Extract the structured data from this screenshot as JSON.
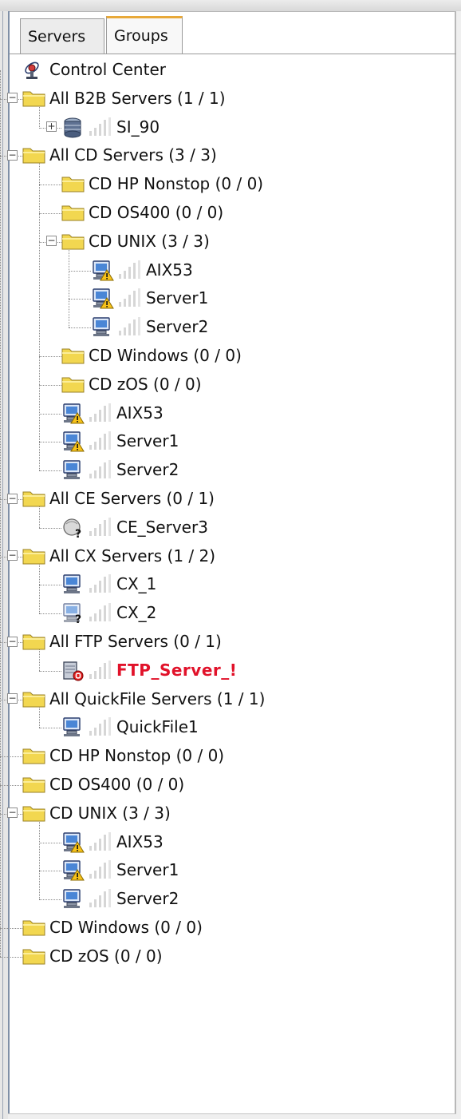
{
  "tabs": [
    {
      "label": "Servers",
      "selected": false
    },
    {
      "label": "Groups",
      "selected": true
    }
  ],
  "colors": {
    "error_text": "#e1122a",
    "tab_accent": "#e8a93a",
    "folder": "#f2d750"
  },
  "tree": [
    {
      "label": "Control Center",
      "icon": "control-center-icon",
      "level": 0
    },
    {
      "label": "All B2B Servers (1 / 1)",
      "icon": "folder-icon",
      "level": 0,
      "expander": "minus"
    },
    {
      "label": "SI_90",
      "icon": "database-server-icon",
      "level": 1,
      "expander": "plus",
      "signal": true
    },
    {
      "label": "All CD Servers (3 / 3)",
      "icon": "folder-icon",
      "level": 0,
      "expander": "minus"
    },
    {
      "label": "CD HP Nonstop (0 / 0)",
      "icon": "folder-icon",
      "level": 1
    },
    {
      "label": "CD OS400 (0 / 0)",
      "icon": "folder-icon",
      "level": 1
    },
    {
      "label": "CD UNIX (3 / 3)",
      "icon": "folder-icon",
      "level": 1,
      "expander": "minus"
    },
    {
      "label": "AIX53",
      "icon": "server-warning-icon",
      "level": 2,
      "signal": true
    },
    {
      "label": "Server1",
      "icon": "server-warning-icon",
      "level": 2,
      "signal": true
    },
    {
      "label": "Server2",
      "icon": "server-icon",
      "level": 2,
      "signal": true
    },
    {
      "label": "CD Windows (0 / 0)",
      "icon": "folder-icon",
      "level": 1
    },
    {
      "label": "CD zOS (0 / 0)",
      "icon": "folder-icon",
      "level": 1
    },
    {
      "label": "AIX53",
      "icon": "server-warning-icon",
      "level": 1,
      "signal": true
    },
    {
      "label": "Server1",
      "icon": "server-warning-icon",
      "level": 1,
      "signal": true
    },
    {
      "label": "Server2",
      "icon": "server-icon",
      "level": 1,
      "signal": true
    },
    {
      "label": "All CE Servers (0 / 1)",
      "icon": "folder-icon",
      "level": 0,
      "expander": "minus"
    },
    {
      "label": "CE_Server3",
      "icon": "unknown-ce-server-icon",
      "level": 1,
      "signal": true
    },
    {
      "label": "All CX Servers (1 / 2)",
      "icon": "folder-icon",
      "level": 0,
      "expander": "minus"
    },
    {
      "label": "CX_1",
      "icon": "server-icon",
      "level": 1,
      "signal": true
    },
    {
      "label": "CX_2",
      "icon": "server-unknown-icon",
      "level": 1,
      "signal": true
    },
    {
      "label": "All FTP Servers (0 / 1)",
      "icon": "folder-icon",
      "level": 0,
      "expander": "minus"
    },
    {
      "label": "FTP_Server_!",
      "icon": "ftp-server-error-icon",
      "level": 1,
      "signal": true,
      "error": true
    },
    {
      "label": "All QuickFile Servers (1 / 1)",
      "icon": "folder-icon",
      "level": 0,
      "expander": "minus"
    },
    {
      "label": "QuickFile1",
      "icon": "server-icon",
      "level": 1,
      "signal": true
    },
    {
      "label": "CD HP Nonstop (0 / 0)",
      "icon": "folder-icon",
      "level": 0
    },
    {
      "label": "CD OS400 (0 / 0)",
      "icon": "folder-icon",
      "level": 0
    },
    {
      "label": "CD UNIX (3 / 3)",
      "icon": "folder-icon",
      "level": 0,
      "expander": "minus"
    },
    {
      "label": "AIX53",
      "icon": "server-warning-icon",
      "level": 1,
      "signal": true
    },
    {
      "label": "Server1",
      "icon": "server-warning-icon",
      "level": 1,
      "signal": true
    },
    {
      "label": "Server2",
      "icon": "server-icon",
      "level": 1,
      "signal": true
    },
    {
      "label": "CD Windows (0 / 0)",
      "icon": "folder-icon",
      "level": 0
    },
    {
      "label": "CD zOS (0 / 0)",
      "icon": "folder-icon",
      "level": 0
    }
  ]
}
